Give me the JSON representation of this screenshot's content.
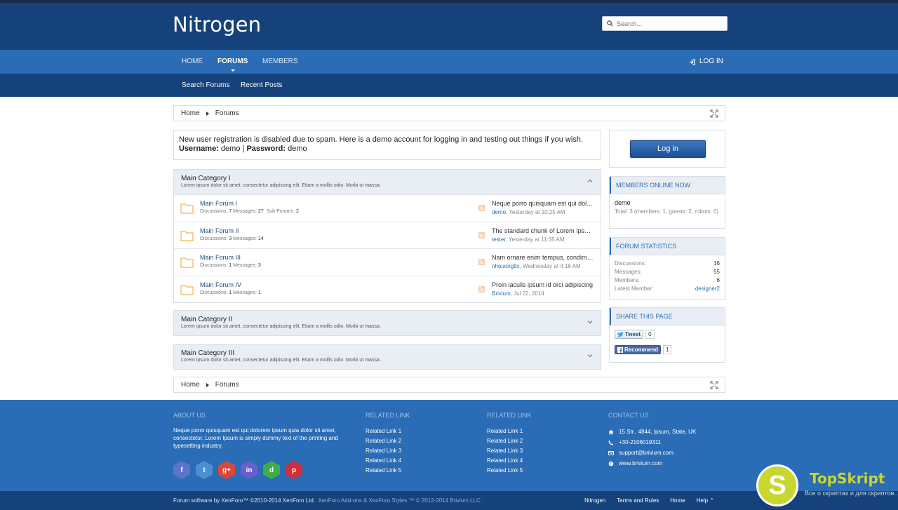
{
  "site": {
    "logo": "Nitrogen"
  },
  "search": {
    "placeholder": "Search..."
  },
  "nav": {
    "tabs": [
      {
        "label": "HOME"
      },
      {
        "label": "FORUMS"
      },
      {
        "label": "MEMBERS"
      }
    ],
    "login_label": "LOG IN"
  },
  "subnav": {
    "items": [
      "Search Forums",
      "Recent Posts"
    ]
  },
  "breadcrumb": {
    "home": "Home",
    "current": "Forums"
  },
  "notice": {
    "text": "New user registration is disabled due to spam. Here is a demo account for logging in and testing out things if you wish.",
    "username_label": "Username:",
    "username": "demo",
    "separator": "|",
    "password_label": "Password:",
    "password": "demo"
  },
  "categories": [
    {
      "title": "Main Category I",
      "desc": "Lorem ipsum dolor sit amet, consectetur adipiscing elit. Etiam a mollis odio. Morbi ut massa.",
      "forums": [
        {
          "title": "Main Forum I",
          "discussions_label": "Discussions:",
          "discussions": "7",
          "messages_label": "Messages:",
          "messages": "27",
          "subforums_label": "Sub-Forums:",
          "subforums": "2",
          "last_title": "Neque porro quisquam est qui dolorem ipsum",
          "last_user": "demo",
          "last_time": "Yesterday at 10:25 AM"
        },
        {
          "title": "Main Forum II",
          "discussions_label": "Discussions:",
          "discussions": "3",
          "messages_label": "Messages:",
          "messages": "14",
          "last_title": "The standard chunk of Lorem Ipsum used",
          "last_user": "tester",
          "last_time": "Yesterday at 11:35 AM"
        },
        {
          "title": "Main Forum III",
          "discussions_label": "Discussions:",
          "discussions": "1",
          "messages_label": "Messages:",
          "messages": "3",
          "last_title": "Nam ornare enim tempus, condimentum",
          "last_user": "nhouong9x",
          "last_time": "Wednesday at 4:16 AM"
        },
        {
          "title": "Main Forum IV",
          "discussions_label": "Discussions:",
          "discussions": "1",
          "messages_label": "Messages:",
          "messages": "1",
          "last_title": "Proin iaculis ipsum id orci adipiscing",
          "last_user": "Brivium",
          "last_time": "Jul 22, 2014"
        }
      ]
    },
    {
      "title": "Main Category II",
      "desc": "Lorem ipsum dolor sit amet, consectetur adipiscing elit. Etiam a mollis odio. Morbi ut massa."
    },
    {
      "title": "Main Category III",
      "desc": "Lorem ipsum dolor sit amet, consectetur adipiscing elit. Etiam a mollis odio. Morbi ut massa."
    }
  ],
  "sidebar": {
    "login_button": "Log in",
    "online": {
      "title": "MEMBERS ONLINE NOW",
      "user": "demo",
      "total": "Total: 3 (members: 1, guests: 2, robots: 0)"
    },
    "stats": {
      "title": "FORUM STATISTICS",
      "rows": [
        {
          "label": "Discussions:",
          "value": "16"
        },
        {
          "label": "Messages:",
          "value": "55"
        },
        {
          "label": "Members:",
          "value": "6"
        },
        {
          "label": "Latest Member:",
          "value": "designer2"
        }
      ]
    },
    "share": {
      "title": "SHARE THIS PAGE",
      "tweet": "Tweet",
      "tweet_count": "0",
      "recommend": "Recommend",
      "recommend_count": "1"
    }
  },
  "footer": {
    "about": {
      "title": "ABOUT US",
      "text": "Neque porro quisquam est qui dolorem ipsum quia dolor sit amet, consectetur. Lorem Ipsum is simply dummy text of the printing and typesetting industry."
    },
    "social_icons": [
      "facebook-icon",
      "twitter-icon",
      "google-plus-icon",
      "linkedin-icon",
      "deviantart-icon",
      "pinterest-icon"
    ],
    "social_glyphs": [
      "f",
      "t",
      "g+",
      "in",
      "d",
      "p"
    ],
    "social_colors": [
      "#5b73c8",
      "#4a8fd1",
      "#d9483b",
      "#6a5fd0",
      "#3fae49",
      "#cf2e3d"
    ],
    "related1": {
      "title": "RELATED LINK",
      "links": [
        "Related Link 1",
        "Related Link 2",
        "Related Link 3",
        "Related Link 4",
        "Related Link 5"
      ]
    },
    "related2": {
      "title": "RELATED LINK",
      "links": [
        "Related Link 1",
        "Related Link 2",
        "Related Link 3",
        "Related Link 4",
        "Related Link 5"
      ]
    },
    "contact": {
      "title": "CONTACT US",
      "address": "15 Str., 4844, Ipsum, State, UK",
      "phone": "+30-2106019311",
      "email": "support@brivium.com",
      "web": "www.brivium.com"
    }
  },
  "bottom": {
    "copyright": "Forum software by XenForo™ ©2010-2014 XenForo Ltd.",
    "addons": "XenForo Add-ons & XenForo Styles ™ © 2012-2014 Brivium LLC.",
    "links": [
      "Nitrogen",
      "Terms and Rules",
      "Home",
      "Help"
    ]
  },
  "watermark": {
    "letter": "S",
    "title": "TopSkript",
    "subtitle": "Все о скриптах и для скриптов..."
  },
  "colors": {
    "header": "#15427a",
    "navbar": "#2a6cb5",
    "footer": "#2a6cb5",
    "accent": "#2a6cb5"
  }
}
